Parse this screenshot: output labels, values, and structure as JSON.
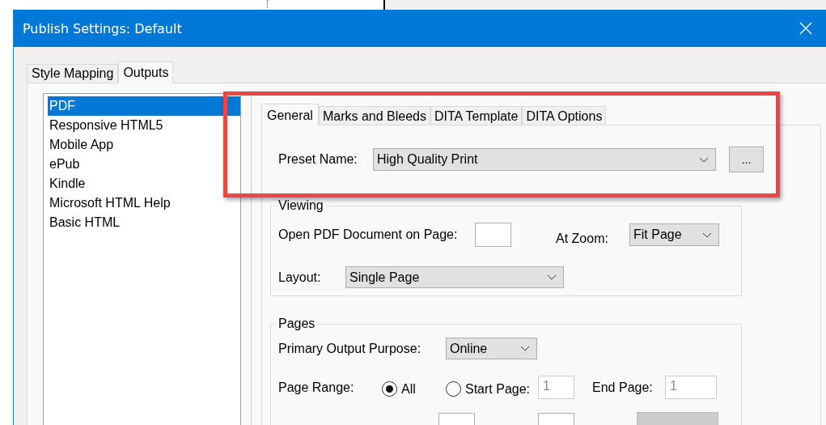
{
  "window": {
    "title": "Publish Settings: Default"
  },
  "tabs": [
    {
      "label": "Style Mapping",
      "selected": false
    },
    {
      "label": "Outputs",
      "selected": true
    }
  ],
  "outputs": [
    {
      "label": "PDF",
      "selected": true
    },
    {
      "label": "Responsive HTML5",
      "selected": false
    },
    {
      "label": "Mobile App",
      "selected": false
    },
    {
      "label": "ePub",
      "selected": false
    },
    {
      "label": "Kindle",
      "selected": false
    },
    {
      "label": "Microsoft HTML Help",
      "selected": false
    },
    {
      "label": "Basic HTML",
      "selected": false
    }
  ],
  "pdf_tabs": [
    {
      "label": "General",
      "selected": true
    },
    {
      "label": "Marks and Bleeds",
      "selected": false
    },
    {
      "label": "DITA Template",
      "selected": false
    },
    {
      "label": "DITA Options",
      "selected": false
    }
  ],
  "preset": {
    "label": "Preset Name:",
    "value": "High Quality Print",
    "button": "..."
  },
  "viewing": {
    "title": "Viewing",
    "open_page_label": "Open PDF Document on Page:",
    "zoom_label": "At Zoom:",
    "zoom_value": "Fit Page",
    "layout_label": "Layout:",
    "layout_value": "Single Page"
  },
  "pages": {
    "title": "Pages",
    "purpose_label": "Primary Output Purpose:",
    "purpose_value": "Online",
    "range_label": "Page Range:",
    "range_options": [
      {
        "label": "All",
        "selected": true
      },
      {
        "label": "Start Page:",
        "selected": false
      }
    ],
    "start_page": {
      "value": "1",
      "disabled": true
    },
    "end_page_label": "End Page:",
    "end_page": {
      "value": "1",
      "disabled": true
    }
  }
}
